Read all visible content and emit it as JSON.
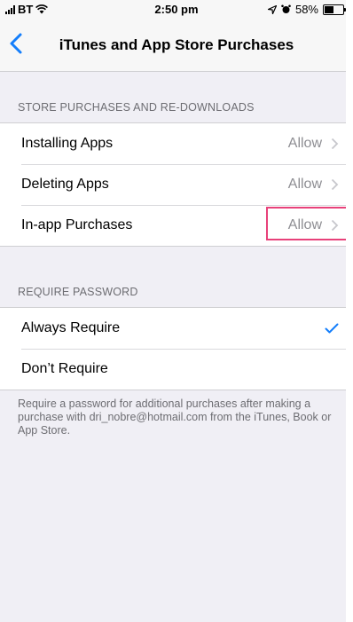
{
  "status_bar": {
    "carrier": "BT",
    "time": "2:50 pm",
    "battery_percent": "58%",
    "battery_level": 0.58
  },
  "nav": {
    "title": "iTunes and App Store Purchases"
  },
  "sections": [
    {
      "header": "STORE PURCHASES AND RE-DOWNLOADS",
      "rows": [
        {
          "label": "Installing Apps",
          "value": "Allow"
        },
        {
          "label": "Deleting Apps",
          "value": "Allow"
        },
        {
          "label": "In-app Purchases",
          "value": "Allow"
        }
      ]
    },
    {
      "header": "REQUIRE PASSWORD",
      "rows": [
        {
          "label": "Always Require",
          "selected": true
        },
        {
          "label": "Don’t Require",
          "selected": false
        }
      ],
      "footer": "Require a password for additional purchases after making a purchase with dri_nobre@hotmail.com from the iTunes, Book or App Store."
    }
  ],
  "colors": {
    "accent": "#147efb",
    "highlight": "#e8417a",
    "background": "#f0eff5"
  }
}
